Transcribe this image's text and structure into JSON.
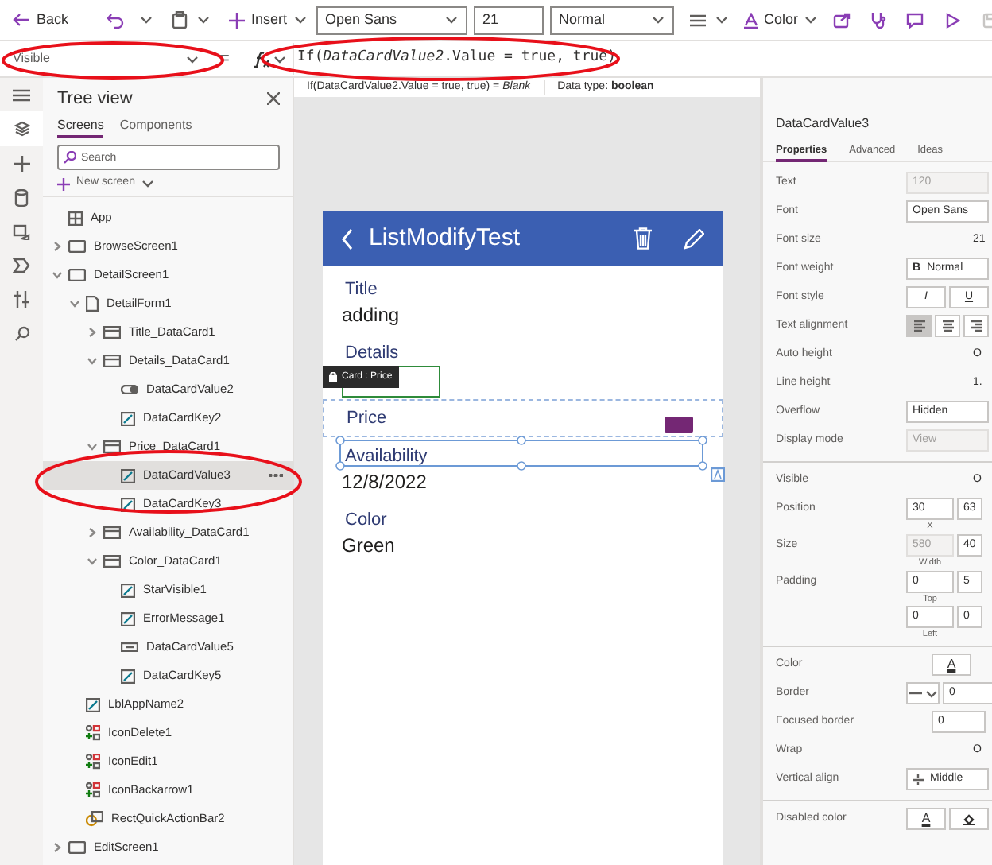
{
  "toolbar": {
    "back": "Back",
    "insert": "Insert",
    "font": "Open Sans",
    "font_size": "21",
    "font_weight": "Normal",
    "color_menu": "Color"
  },
  "formula_bar": {
    "property": "Visible",
    "equals": "=",
    "formula": "If(*DataCardValue2*.Value = true, true)",
    "result": "If(DataCardValue2.Value = true, true)  =  *Blank*",
    "data_type": "Data type: **boolean**"
  },
  "tree_view": {
    "title": "Tree view",
    "tabs": [
      {
        "label": "Screens",
        "selected": true
      },
      {
        "label": "Components",
        "selected": false
      }
    ],
    "search": {
      "placeholder": "Search"
    },
    "new_screen": "New screen",
    "items": [
      {
        "label": "App",
        "kind": "app",
        "selected": false
      },
      {
        "label": "BrowseScreen1",
        "kind": "screen",
        "expanded": false,
        "selected": false
      },
      {
        "label": "DetailScreen1",
        "kind": "screen",
        "expanded": true,
        "selected": false,
        "children": [
          {
            "label": "DetailForm1",
            "kind": "form",
            "expanded": true,
            "selected": false,
            "children": [
              {
                "label": "Title_DataCard1",
                "kind": "card",
                "expanded": false,
                "selected": false
              },
              {
                "label": "Details_DataCard1",
                "kind": "card",
                "expanded": true,
                "selected": false,
                "children": [
                  {
                    "label": "DataCardValue2",
                    "kind": "toggle",
                    "selected": false
                  },
                  {
                    "label": "DataCardKey2",
                    "kind": "label",
                    "selected": false
                  }
                ]
              },
              {
                "label": "Price_DataCard1",
                "kind": "card",
                "expanded": true,
                "selected": false,
                "children": [
                  {
                    "label": "DataCardValue3",
                    "kind": "label",
                    "selected": true
                  },
                  {
                    "label": "DataCardKey3",
                    "kind": "label",
                    "selected": false
                  }
                ]
              },
              {
                "label": "Availability_DataCard1",
                "kind": "card",
                "expanded": false,
                "selected": false
              },
              {
                "label": "Color_DataCard1",
                "kind": "card",
                "expanded": true,
                "selected": false,
                "children": [
                  {
                    "label": "StarVisible1",
                    "kind": "label",
                    "selected": false
                  },
                  {
                    "label": "ErrorMessage1",
                    "kind": "label",
                    "selected": false
                  },
                  {
                    "label": "DataCardValue5",
                    "kind": "input",
                    "selected": false
                  },
                  {
                    "label": "DataCardKey5",
                    "kind": "label",
                    "selected": false
                  }
                ]
              }
            ]
          },
          {
            "label": "LblAppName2",
            "kind": "label",
            "selected": false
          },
          {
            "label": "IconDelete1",
            "kind": "icon",
            "selected": false
          },
          {
            "label": "IconEdit1",
            "kind": "icon",
            "selected": false
          },
          {
            "label": "IconBackarrow1",
            "kind": "icon",
            "selected": false
          },
          {
            "label": "RectQuickActionBar2",
            "kind": "shape",
            "selected": false
          }
        ]
      },
      {
        "label": "EditScreen1",
        "kind": "screen",
        "expanded": false,
        "selected": false
      }
    ]
  },
  "app_screen": {
    "title": "ListModifyTest",
    "tooltip": "Card : Price",
    "fields": [
      {
        "label": "Title",
        "value": "adding",
        "kind": "text"
      },
      {
        "label": "Details",
        "kind": "input"
      },
      {
        "label": "Price",
        "kind": "selected-card"
      },
      {
        "label": "Availability",
        "value": "12/8/2022",
        "kind": "text"
      },
      {
        "label": "Color",
        "value": "Green",
        "kind": "text"
      }
    ]
  },
  "properties": {
    "control": "DataCardValue3",
    "tabs": [
      {
        "label": "Properties",
        "selected": true
      },
      {
        "label": "Advanced",
        "selected": false
      },
      {
        "label": "Ideas",
        "selected": false
      }
    ],
    "sections": [
      [
        {
          "label": "Text",
          "kind": "field",
          "value": "120",
          "disabled": true
        },
        {
          "label": "Font",
          "kind": "field",
          "value": "Open Sans",
          "disabled": false
        },
        {
          "label": "Font size",
          "kind": "number",
          "value": "21"
        },
        {
          "label": "Font weight",
          "kind": "weight",
          "mark": "B",
          "value": "Normal"
        },
        {
          "label": "Font style",
          "kind": "buttons",
          "buttons": [
            "I",
            "U"
          ]
        },
        {
          "label": "Text alignment",
          "kind": "alignment",
          "options": [
            {
              "selected": true
            },
            {
              "selected": false
            },
            {
              "selected": false
            }
          ]
        },
        {
          "label": "Auto height",
          "kind": "number",
          "value": "O"
        },
        {
          "label": "Line height",
          "kind": "number",
          "value": "1."
        },
        {
          "label": "Overflow",
          "kind": "field",
          "value": "Hidden",
          "disabled": false
        },
        {
          "label": "Display mode",
          "kind": "field",
          "value": "View",
          "disabled": true
        }
      ],
      [
        {
          "label": "Visible",
          "kind": "number",
          "value": "O"
        },
        {
          "label": "Position",
          "kind": "pairs",
          "pairs": [
            {
              "values": [
                "30",
                "63"
              ],
              "caption": "X"
            }
          ]
        },
        {
          "label": "Size",
          "kind": "pairs",
          "pairs": [
            {
              "values": [
                "580",
                "40"
              ],
              "caption": "Width"
            }
          ]
        },
        {
          "label": "Padding",
          "kind": "pairs",
          "pairs": [
            {
              "values": [
                "0",
                "5"
              ],
              "caption": "Top"
            },
            {
              "values": [
                "0",
                "0"
              ],
              "caption": "Left"
            }
          ]
        }
      ],
      [
        {
          "label": "Color",
          "kind": "color",
          "value": "A"
        },
        {
          "label": "Border",
          "kind": "border",
          "value": "0"
        },
        {
          "label": "Focused border",
          "kind": "field-short",
          "value": "0"
        },
        {
          "label": "Wrap",
          "kind": "number",
          "value": "O"
        },
        {
          "label": "Vertical align",
          "kind": "valign",
          "value": "Middle"
        }
      ],
      [
        {
          "label": "Disabled color",
          "kind": "color-fill",
          "value": "A"
        }
      ]
    ]
  }
}
